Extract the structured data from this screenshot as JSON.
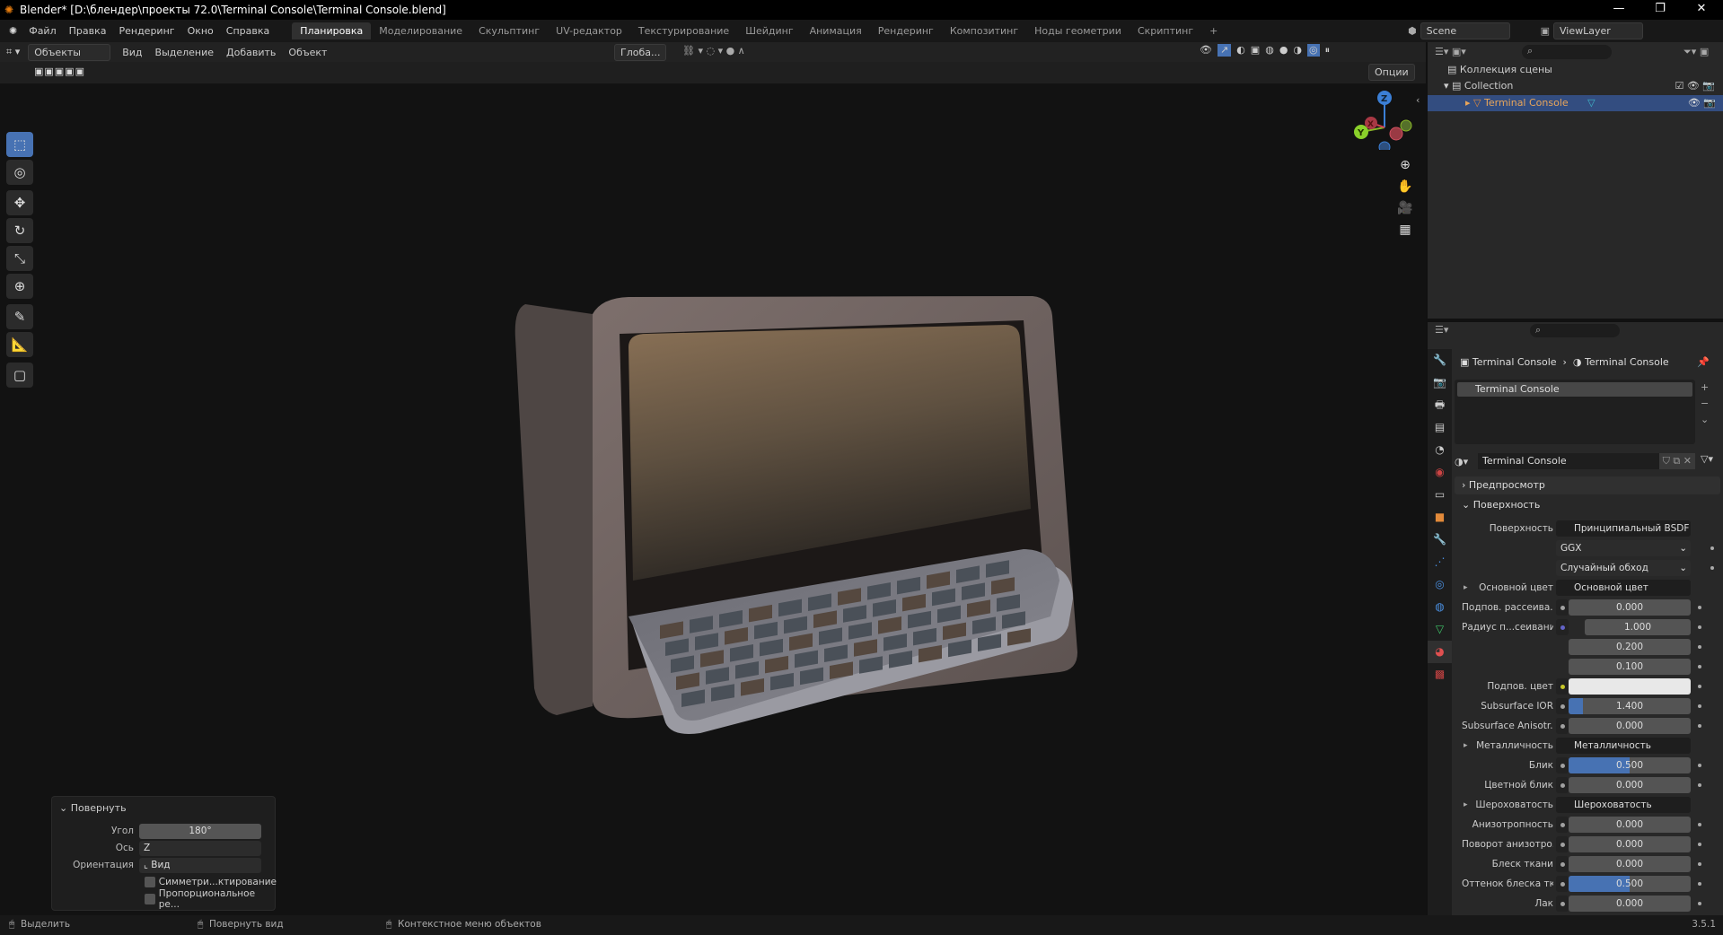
{
  "window": {
    "title": "Blender* [D:\\блендер\\проекты 72.0\\Terminal Console\\Terminal Console.blend]",
    "min": "—",
    "max": "❐",
    "close": "✕"
  },
  "menu": [
    "Файл",
    "Правка",
    "Рендеринг",
    "Окно",
    "Справка"
  ],
  "workspaces": [
    "Планировка",
    "Моделирование",
    "Скульптинг",
    "UV-редактор",
    "Текстурирование",
    "Шейдинг",
    "Анимация",
    "Рендеринг",
    "Композитинг",
    "Ноды геометрии",
    "Скриптинг",
    "+"
  ],
  "active_workspace": 0,
  "scene": "Scene",
  "view_layer": "ViewLayer",
  "viewport_header": {
    "mode": "Объекты",
    "items": [
      "Вид",
      "Выделение",
      "Добавить",
      "Объект"
    ],
    "orientation": "Глоба...",
    "options": "Опции"
  },
  "gizmo": {
    "z": "Z",
    "y": "Y",
    "x": "X"
  },
  "outliner": {
    "root": "Коллекция сцены",
    "collection": "Collection",
    "object": "Terminal Console"
  },
  "properties": {
    "breadcrumb_object": "Terminal Console",
    "breadcrumb_material": "Terminal Console",
    "slot": "Terminal Console",
    "material_name": "Terminal Console",
    "sections": {
      "preview": "Предпросмотр",
      "surface": "Поверхность"
    },
    "rows": [
      {
        "label": "Поверхность",
        "type": "link",
        "value": "Принципиальный BSDF",
        "socket": "#4fc14f"
      },
      {
        "label": "",
        "type": "enum",
        "value": "GGX"
      },
      {
        "label": "",
        "type": "enum",
        "value": "Случайный обход"
      },
      {
        "label": "Основной цвет",
        "type": "link",
        "value": "Основной цвет",
        "socket": "#c7c729",
        "expand": true
      },
      {
        "label": "Подпов. рассеива...",
        "type": "num",
        "value": "0.000",
        "fill": 0,
        "socket": "#a1a1a1"
      },
      {
        "label": "Радиус п...сеивания",
        "type": "num",
        "value": "1.000",
        "fill": 0,
        "socket": "#6363c7",
        "indent": true
      },
      {
        "label": "",
        "type": "num",
        "value": "0.200",
        "fill": 0,
        "indent": true
      },
      {
        "label": "",
        "type": "num",
        "value": "0.100",
        "fill": 0,
        "indent": true
      },
      {
        "label": "Подпов. цвет",
        "type": "color",
        "value": "",
        "color": "#e8e8e8",
        "socket": "#c7c729"
      },
      {
        "label": "Subsurface IOR",
        "type": "num",
        "value": "1.400",
        "fill": 0.12,
        "socket": "#a1a1a1"
      },
      {
        "label": "Subsurface Anisotr...",
        "type": "num",
        "value": "0.000",
        "fill": 0,
        "socket": "#a1a1a1"
      },
      {
        "label": "Металличность",
        "type": "link",
        "value": "Металличность",
        "socket": "#a1a1a1",
        "expand": true
      },
      {
        "label": "Блик",
        "type": "num",
        "value": "0.500",
        "fill": 0.5,
        "socket": "#a1a1a1"
      },
      {
        "label": "Цветной блик",
        "type": "num",
        "value": "0.000",
        "fill": 0,
        "socket": "#a1a1a1"
      },
      {
        "label": "Шероховатость",
        "type": "link",
        "value": "Шероховатость",
        "socket": "#a1a1a1",
        "expand": true
      },
      {
        "label": "Анизотропность",
        "type": "num",
        "value": "0.000",
        "fill": 0,
        "socket": "#a1a1a1"
      },
      {
        "label": "Поворот анизотро...",
        "type": "num",
        "value": "0.000",
        "fill": 0,
        "socket": "#a1a1a1"
      },
      {
        "label": "Блеск ткани",
        "type": "num",
        "value": "0.000",
        "fill": 0,
        "socket": "#a1a1a1"
      },
      {
        "label": "Оттенок блеска тк...",
        "type": "num",
        "value": "0.500",
        "fill": 0.5,
        "socket": "#a1a1a1"
      },
      {
        "label": "Лак",
        "type": "num",
        "value": "0.000",
        "fill": 0,
        "socket": "#a1a1a1"
      }
    ]
  },
  "operator_panel": {
    "title": "Повернуть",
    "angle_label": "Угол",
    "angle": "180°",
    "axis_label": "Ось",
    "axis": "Z",
    "orient_label": "Ориентация",
    "orient": "Вид",
    "symmetry": "Симметри...ктирование",
    "proportional": "Пропорциональное ре..."
  },
  "status": {
    "select": "Выделить",
    "rotate": "Повернуть вид",
    "context": "Контекстное меню объектов",
    "version": "3.5.1"
  },
  "colors": {
    "accent": "#4772b3",
    "selected_row": "#334d80"
  }
}
